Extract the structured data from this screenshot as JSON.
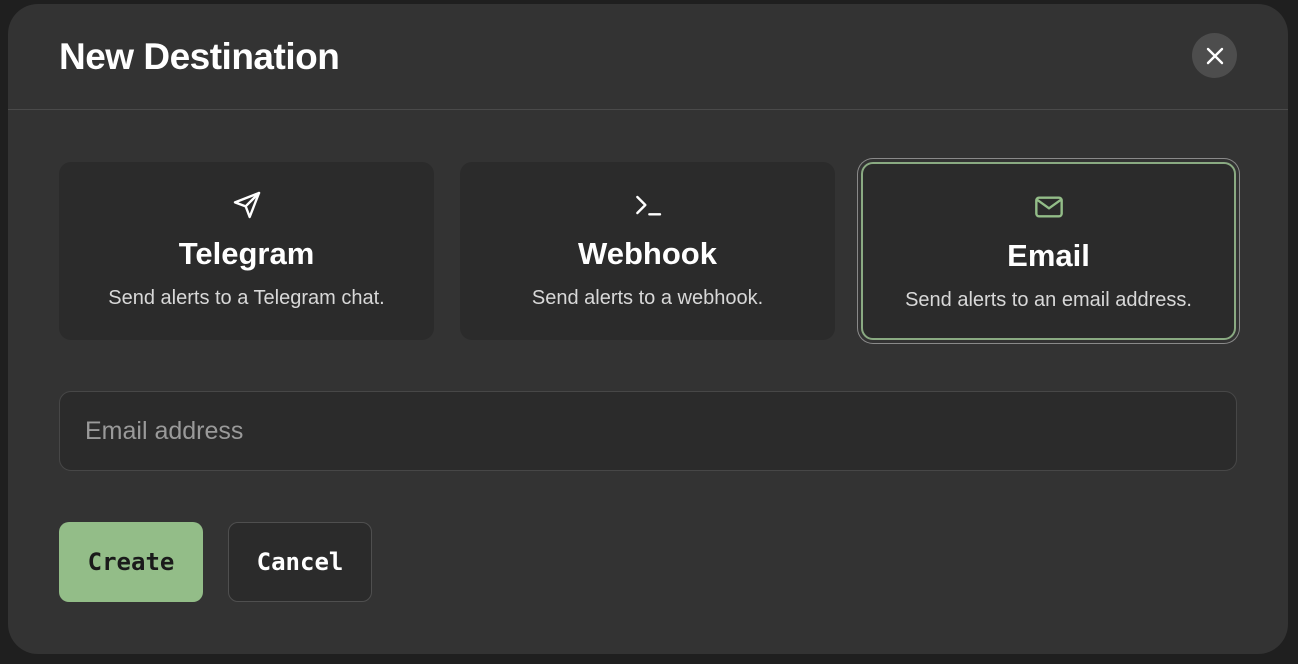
{
  "modal": {
    "title": "New Destination"
  },
  "options": [
    {
      "icon": "send-icon",
      "title": "Telegram",
      "description": "Send alerts to a Telegram chat.",
      "selected": false
    },
    {
      "icon": "terminal-icon",
      "title": "Webhook",
      "description": "Send alerts to a webhook.",
      "selected": false
    },
    {
      "icon": "mail-icon",
      "title": "Email",
      "description": "Send alerts to an email address.",
      "selected": true
    }
  ],
  "form": {
    "email_placeholder": "Email address",
    "email_value": ""
  },
  "actions": {
    "create_label": "Create",
    "cancel_label": "Cancel"
  },
  "colors": {
    "accent": "#93bd88",
    "modal_bg": "#333333",
    "card_bg": "#2b2b2b"
  }
}
